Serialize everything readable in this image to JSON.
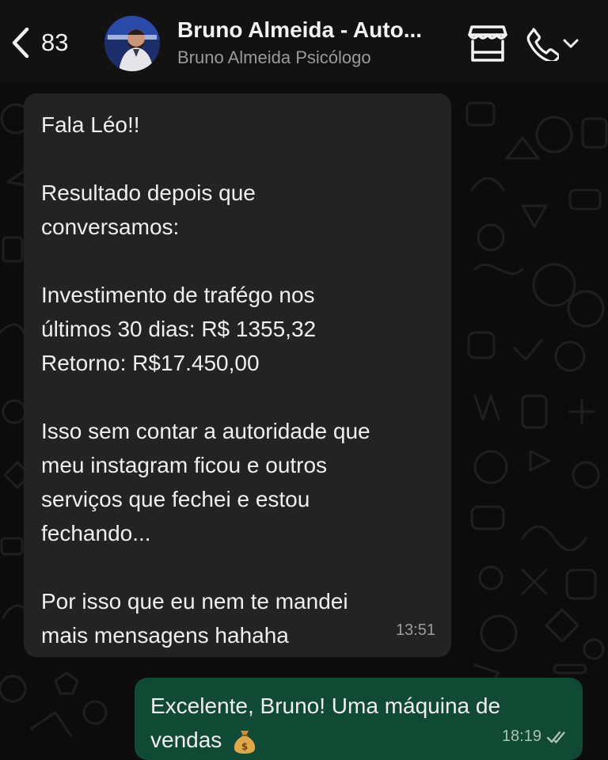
{
  "header": {
    "back_count": "83",
    "contact_name": "Bruno Almeida - Auto...",
    "contact_subtitle": "Bruno Almeida Psicólogo"
  },
  "incoming": {
    "lines": [
      "Fala Léo!!",
      "",
      "Resultado depois que",
      "conversamos:",
      "",
      "Investimento de trafégo nos",
      "últimos 30 dias: R$ 1355,32",
      "Retorno: R$17.450,00",
      "",
      "Isso sem contar a autoridade que",
      "meu instagram ficou e outros",
      "serviços que fechei e estou",
      "fechando...",
      "",
      "Por isso que eu nem te mandei",
      "mais mensagens hahaha"
    ],
    "time": "13:51"
  },
  "outgoing": {
    "line1": "Excelente, Bruno! Uma máquina de",
    "line2": "vendas",
    "emoji": "moneybag-icon",
    "time": "18:19"
  },
  "colors": {
    "header_bg": "#121212",
    "incoming_bubble": "#232323",
    "outgoing_bubble": "#114a34",
    "read_ticks": "#a9c2b6"
  }
}
